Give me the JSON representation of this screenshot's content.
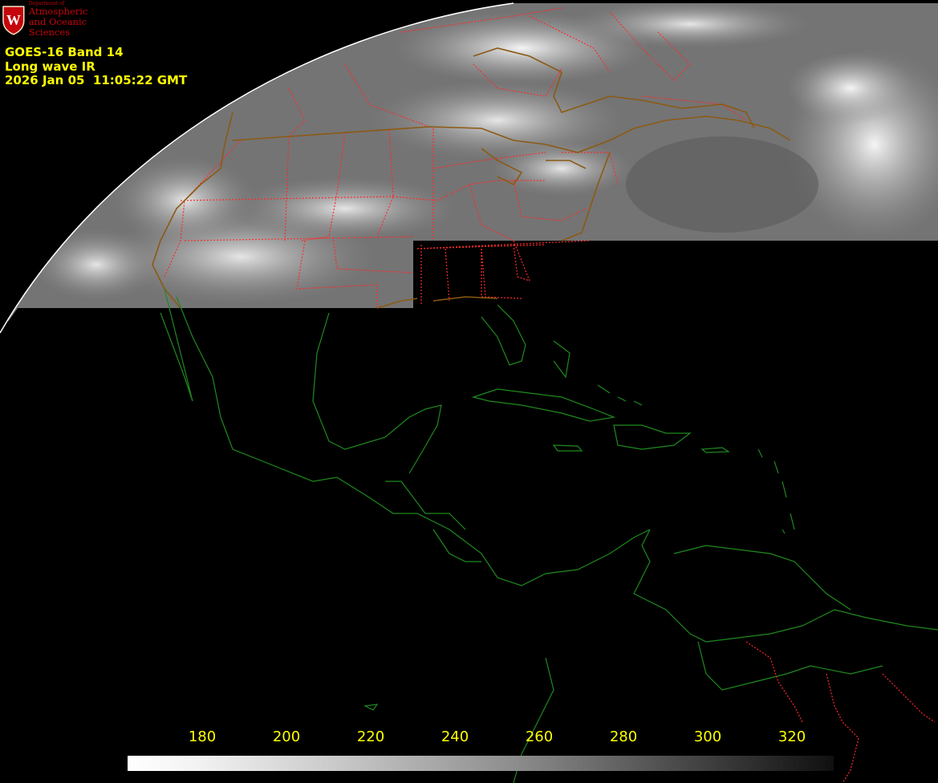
{
  "logo": {
    "department": "Department of",
    "line1": "Atmospheric",
    "line2": "and Oceanic Sciences",
    "seal_letter": "W",
    "seal_color": "#c5050c"
  },
  "header": {
    "product": "GOES-16 Band 14",
    "channel": "Long wave IR",
    "timestamp": "2026 Jan 05  11:05:22 GMT"
  },
  "colorbar": {
    "ticks": [
      "180",
      "200",
      "220",
      "240",
      "260",
      "280",
      "300",
      "320"
    ],
    "tick_color": "#ffff00",
    "from_color": "#ffffff",
    "to_color": "#000000"
  },
  "map_colors": {
    "state_borders": "#ff2a2a",
    "coastlines_imaged": "#8b5a14",
    "coastlines_dark": "#1f8a1f",
    "space": "#000000"
  }
}
